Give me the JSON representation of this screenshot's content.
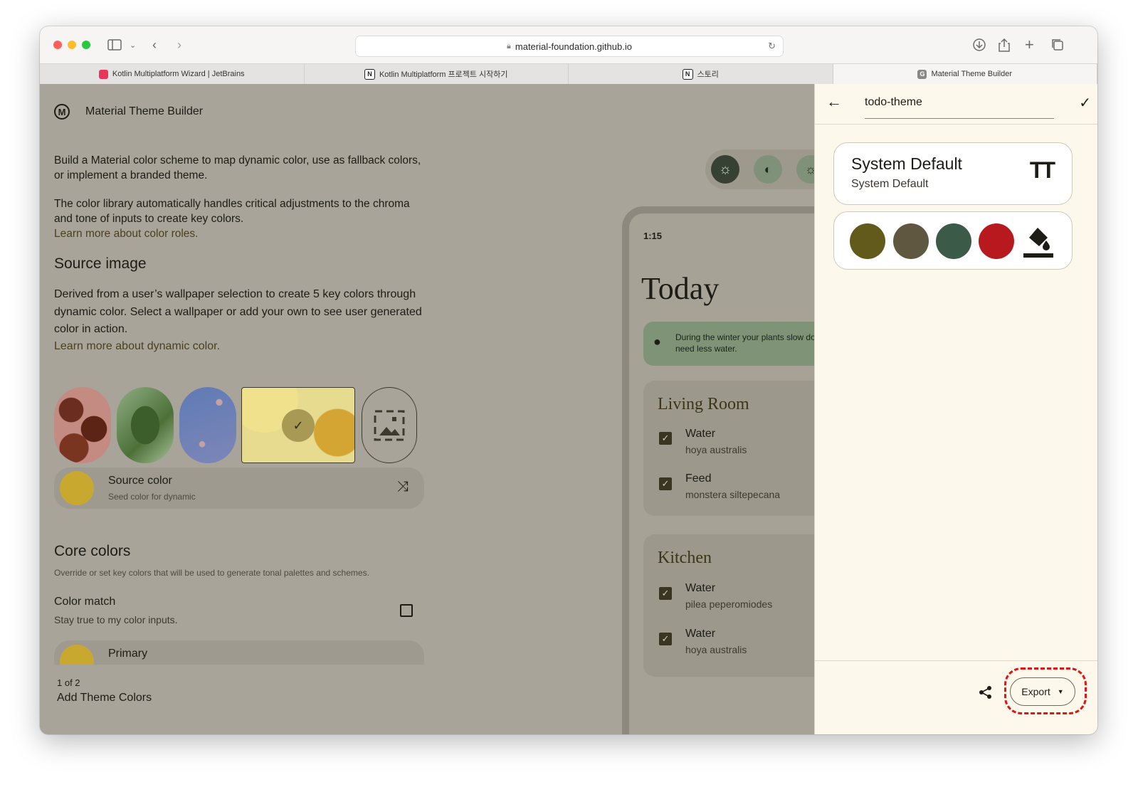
{
  "browser": {
    "url": "material-foundation.github.io",
    "tabs": [
      {
        "label": "Kotlin Multiplatform Wizard | JetBrains",
        "favicon": "jetbrains-icon"
      },
      {
        "label": "Kotlin Multiplatform 프로젝트 시작하기",
        "favicon": "notion-icon"
      },
      {
        "label": "스토리",
        "favicon": "notion-icon"
      },
      {
        "label": "Material Theme Builder",
        "favicon": "material-g-icon"
      }
    ]
  },
  "app": {
    "title": "Material Theme Builder"
  },
  "intro": {
    "p1": "Build a Material color scheme to map dynamic color, use as fallback colors, or implement a branded theme.",
    "p2": "The color library automatically handles critical adjustments to the chroma and tone of inputs to create key colors.",
    "link1": "Learn more about color roles."
  },
  "source_image": {
    "heading": "Source image",
    "description": "Derived from a user’s wallpaper selection to create 5 key colors through dynamic color. Select a wallpaper or add your own to see user generated color in action.",
    "link": "Learn more about dynamic color.",
    "source_color_label": "Source color",
    "source_color_sub": "Seed color for dynamic",
    "source_color": "#c9a830"
  },
  "core_colors": {
    "heading": "Core colors",
    "description": "Override or set key colors that will be used to generate tonal palettes and schemes.",
    "color_match_label": "Color match",
    "color_match_sub": "Stay true to my color inputs.",
    "primary_label": "Primary",
    "primary_color": "#c9a830"
  },
  "pager": {
    "count": "1 of 2",
    "label": "Add Theme Colors"
  },
  "preview": {
    "time": "1:15",
    "title": "Today",
    "tip": "During the winter your plants slow down and need less water.",
    "rooms": [
      {
        "name": "Living Room",
        "tasks": [
          {
            "task": "Water",
            "plant": "hoya australis"
          },
          {
            "task": "Feed",
            "plant": "monstera siltepecana"
          }
        ]
      },
      {
        "name": "Kitchen",
        "tasks": [
          {
            "task": "Water",
            "plant": "pilea peperomiodes"
          },
          {
            "task": "Water",
            "plant": "hoya australis"
          }
        ]
      }
    ]
  },
  "panel": {
    "theme_name": "todo-theme",
    "font_title": "System Default",
    "font_sub": "System Default",
    "swatches": [
      "#615a1b",
      "#5f5740",
      "#3b5a48",
      "#b8191f"
    ],
    "export_label": "Export"
  }
}
